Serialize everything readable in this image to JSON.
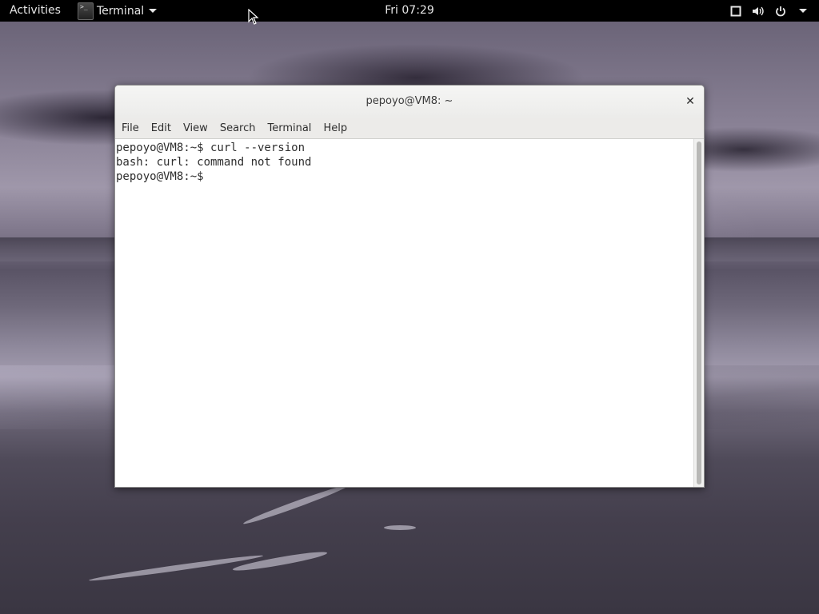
{
  "topbar": {
    "activities": "Activities",
    "app_name": "Terminal",
    "clock": "Fri 07:29",
    "tray_icons": [
      "window-icon",
      "volume-icon",
      "power-icon",
      "chevron-down-icon"
    ]
  },
  "window": {
    "title": "pepoyo@VM8: ~",
    "menu": [
      "File",
      "Edit",
      "View",
      "Search",
      "Terminal",
      "Help"
    ],
    "lines": [
      "pepoyo@VM8:~$ curl --version",
      "bash: curl: command not found",
      "pepoyo@VM8:~$ "
    ]
  },
  "colors": {
    "topbar_bg": "#000000",
    "terminal_bg": "#ffffff",
    "terminal_text": "#2e2e2e"
  }
}
